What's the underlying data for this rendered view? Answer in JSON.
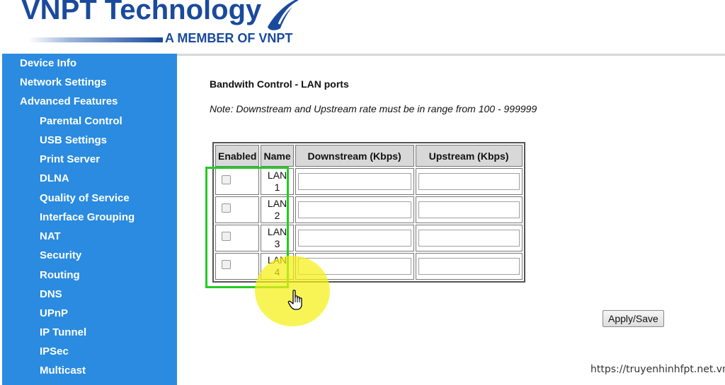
{
  "header": {
    "brand": "VNPT Technology",
    "tagline": "A MEMBER OF VNPT"
  },
  "sidebar": {
    "items": [
      {
        "label": "Device Info",
        "level": "top"
      },
      {
        "label": "Network Settings",
        "level": "top"
      },
      {
        "label": "Advanced Features",
        "level": "top"
      },
      {
        "label": "Parental Control",
        "level": "sub"
      },
      {
        "label": "USB Settings",
        "level": "sub"
      },
      {
        "label": "Print Server",
        "level": "sub"
      },
      {
        "label": "DLNA",
        "level": "sub"
      },
      {
        "label": "Quality of Service",
        "level": "sub"
      },
      {
        "label": "Interface Grouping",
        "level": "sub"
      },
      {
        "label": "NAT",
        "level": "sub"
      },
      {
        "label": "Security",
        "level": "sub"
      },
      {
        "label": "Routing",
        "level": "sub"
      },
      {
        "label": "DNS",
        "level": "sub"
      },
      {
        "label": "UPnP",
        "level": "sub"
      },
      {
        "label": "IP Tunnel",
        "level": "sub"
      },
      {
        "label": "IPSec",
        "level": "sub"
      },
      {
        "label": "Multicast",
        "level": "sub"
      }
    ]
  },
  "main": {
    "title": "Bandwith Control - LAN ports",
    "note": "Note: Downstream and Upstream rate must be in range from 100 - 999999",
    "table": {
      "headers": {
        "enabled": "Enabled",
        "name": "Name",
        "downstream": "Downstream (Kbps)",
        "upstream": "Upstream (Kbps)"
      },
      "rows": [
        {
          "name_line1": "LAN",
          "name_line2": "1",
          "enabled": false,
          "downstream": "",
          "upstream": ""
        },
        {
          "name_line1": "LAN",
          "name_line2": "2",
          "enabled": false,
          "downstream": "",
          "upstream": ""
        },
        {
          "name_line1": "LAN",
          "name_line2": "3",
          "enabled": false,
          "downstream": "",
          "upstream": ""
        },
        {
          "name_line1": "LAN",
          "name_line2": "4",
          "enabled": false,
          "downstream": "",
          "upstream": ""
        }
      ]
    },
    "apply_label": "Apply/Save"
  },
  "watermark": "https://truyenhinhfpt.net.vn",
  "colors": {
    "brand": "#1a4a9c",
    "sidebar": "#2a8be0",
    "highlight_box": "#22cc22",
    "cursor_spotlight": "#f5f014"
  }
}
